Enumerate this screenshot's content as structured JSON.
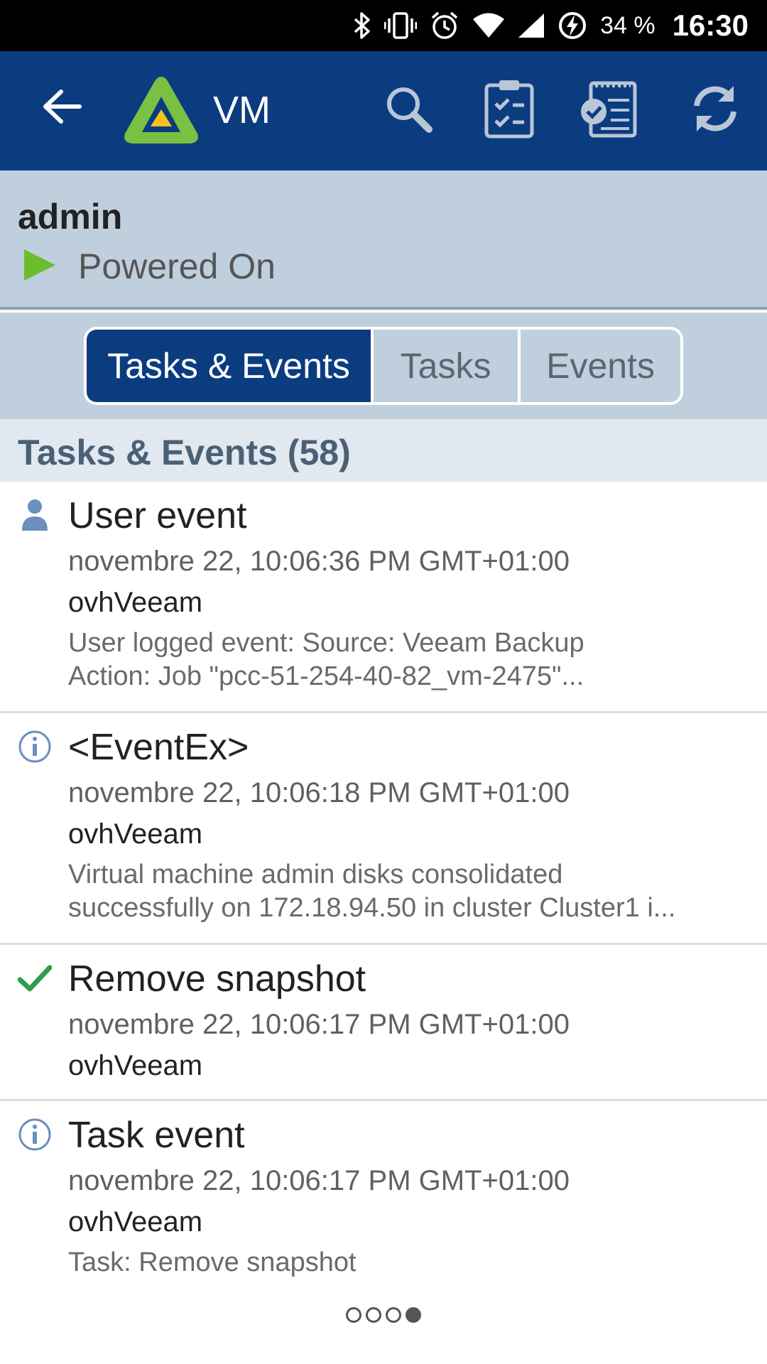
{
  "status_bar": {
    "battery": "34 %",
    "time": "16:30",
    "icons": [
      "bluetooth-icon",
      "vibrate-icon",
      "alarm-icon",
      "wifi-icon",
      "signal-icon",
      "battery-charging-icon"
    ]
  },
  "app_bar": {
    "title": "VM",
    "back_icon": "arrow-left-icon",
    "actions": [
      "search-icon",
      "tasks-clipboard-icon",
      "events-calendar-icon",
      "refresh-icon"
    ],
    "colors": {
      "background": "#0b3c80",
      "logo_green": "#79c043",
      "logo_yellow": "#f6c21a"
    }
  },
  "vm": {
    "name": "admin",
    "state": "Powered On",
    "state_color": "#6cbd2e"
  },
  "tabs": [
    {
      "label": "Tasks & Events",
      "active": true
    },
    {
      "label": "Tasks",
      "active": false
    },
    {
      "label": "Events",
      "active": false
    }
  ],
  "section": {
    "title": "Tasks & Events (58)"
  },
  "items": [
    {
      "icon": "user-icon",
      "name": "User event",
      "date": "novembre 22, 10:06:36 PM GMT+01:00",
      "user": "ovhVeeam",
      "desc_line1": "User logged event: Source: Veeam Backup",
      "desc_line2": "Action: Job \"pcc-51-254-40-82_vm-2475\"..."
    },
    {
      "icon": "info-icon",
      "name": "<EventEx>",
      "date": "novembre 22, 10:06:18 PM GMT+01:00",
      "user": "ovhVeeam",
      "desc_line1": "Virtual machine admin disks consolidated",
      "desc_line2": "successfully on 172.18.94.50 in cluster Cluster1 i..."
    },
    {
      "icon": "checkmark-icon",
      "name": "Remove snapshot",
      "date": "novembre 22, 10:06:17 PM GMT+01:00",
      "user": "ovhVeeam"
    },
    {
      "icon": "info-icon",
      "name": "Task event",
      "date": "novembre 22, 10:06:17 PM GMT+01:00",
      "user": "ovhVeeam",
      "desc_line1": "Task: Remove snapshot"
    }
  ],
  "pager": {
    "pages": 4,
    "current": 4
  }
}
